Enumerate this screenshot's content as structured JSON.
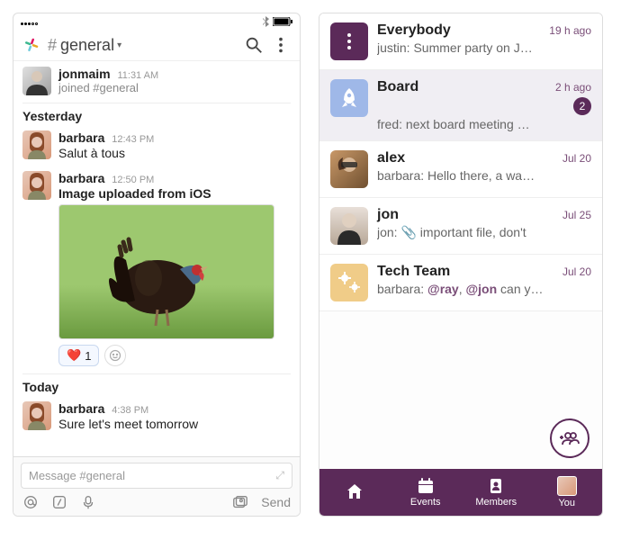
{
  "left": {
    "channel": "general",
    "messages": {
      "jonmaim": {
        "name": "jonmaim",
        "time": "11:31 AM",
        "sub": "joined #general"
      },
      "yesterday_label": "Yesterday",
      "barbara1": {
        "name": "barbara",
        "time": "12:43 PM",
        "text": "Salut à tous"
      },
      "barbara2": {
        "name": "barbara",
        "time": "12:50 PM",
        "title": "Image uploaded from iOS"
      },
      "today_label": "Today",
      "barbara3": {
        "name": "barbara",
        "time": "4:38 PM",
        "text": "Sure let's meet tomorrow"
      }
    },
    "reaction_count": "1",
    "composer_placeholder": "Message #general",
    "send_label": "Send"
  },
  "right": {
    "rows": {
      "everybody": {
        "name": "Everybody",
        "time": "19 h ago",
        "sub": "justin: Summer party on J…"
      },
      "board": {
        "name": "Board",
        "time": "2 h ago",
        "sub": "fred: next board meeting …",
        "badge": "2"
      },
      "alex": {
        "name": "alex",
        "time": "Jul 20",
        "sub": "barbara: Hello there, a wa…"
      },
      "jon": {
        "name": "jon",
        "time": "Jul 25",
        "sub_prefix": "jon: ",
        "sub_suffix": " important file, don't"
      },
      "tech": {
        "name": "Tech Team",
        "time": "Jul 20",
        "sub_prefix": "barbara: ",
        "m1": "@ray",
        "m_sep": ", ",
        "m2": "@jon",
        "sub_suffix": " can y…"
      }
    },
    "tabs": {
      "home": "",
      "events": "Events",
      "members": "Members",
      "you": "You"
    }
  }
}
